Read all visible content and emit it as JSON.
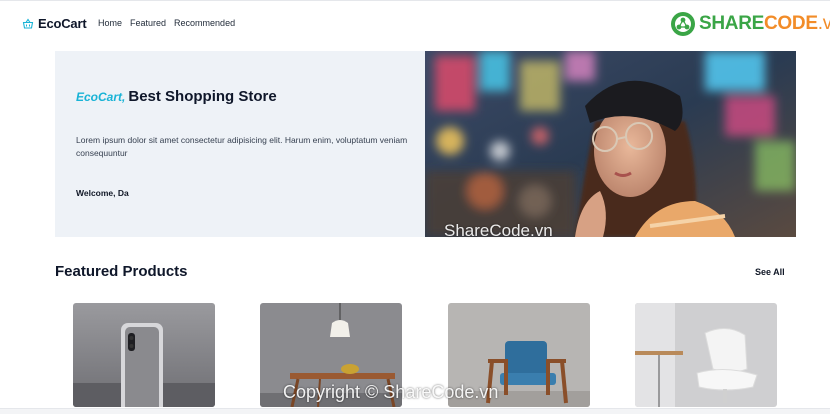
{
  "nav": {
    "brand": "EcoCart",
    "links": [
      "Home",
      "Featured",
      "Recommended"
    ],
    "brand_icon": "basket-icon"
  },
  "watermark_logo": {
    "share": "SHARE",
    "code": "CODE",
    "domain": ".vn"
  },
  "hero": {
    "brand_accent": "EcoCart,",
    "title": "Best Shopping Store",
    "description": "Lorem ipsum dolor sit amet consectetur adipisicing elit. Harum enim, voluptatum veniam consequuntur",
    "welcome": "Welcome, Da"
  },
  "watermarks": {
    "hero": "ShareCode.vn",
    "footer": "Copyright © ShareCode.vn"
  },
  "featured": {
    "title": "Featured Products",
    "see_all": "See All",
    "products": [
      {
        "image": "phone-photo"
      },
      {
        "image": "table-lamp-photo"
      },
      {
        "image": "blue-armchair-photo"
      },
      {
        "image": "white-chair-photo"
      }
    ]
  },
  "colors": {
    "accent": "#19b3d6",
    "hero_bg": "#eef2f7",
    "logo_green": "#3aa546",
    "logo_orange": "#f28c28"
  }
}
